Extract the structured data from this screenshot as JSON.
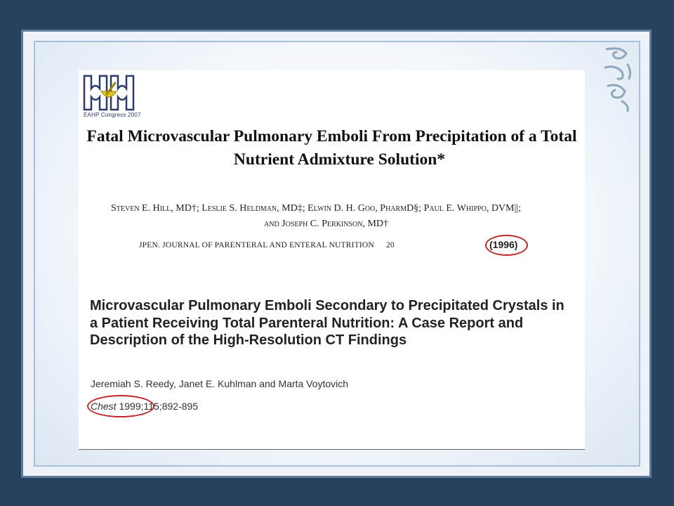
{
  "logo": {
    "alt": "EAHP logo",
    "caption": "EAHP Congress 2007"
  },
  "article1": {
    "title_line1": "Fatal Microvascular Pulmonary Emboli From Precipitation of a Total",
    "title_line2": "Nutrient Admixture Solution*",
    "authors_line1": "Steven E. Hill, MD†; Leslie S. Heldman, MD‡; Elwin D. H. Goo, PharmD§; Paul E. Whippo, DVM||;",
    "authors_line2": "and Joseph C. Perkinson, MD†",
    "journal": "JPEN. JOURNAL OF PARENTERAL AND ENTERAL NUTRITION",
    "volume": "20",
    "year": "(1996)"
  },
  "article2": {
    "title": "Microvascular Pulmonary Emboli Secondary to Precipitated Crystals in a Patient Receiving Total Parenteral Nutrition: A Case Report and Description of the High-Resolution CT Findings",
    "authors": "Jeremiah S. Reedy, Janet E. Kuhlman and Marta Voytovich",
    "journal": "Chest",
    "year": "1999",
    "volume_pages": ";115;892-895"
  },
  "colors": {
    "highlight_ring": "#c0282a",
    "background": "#25425f",
    "frame": "#edf2f8"
  }
}
